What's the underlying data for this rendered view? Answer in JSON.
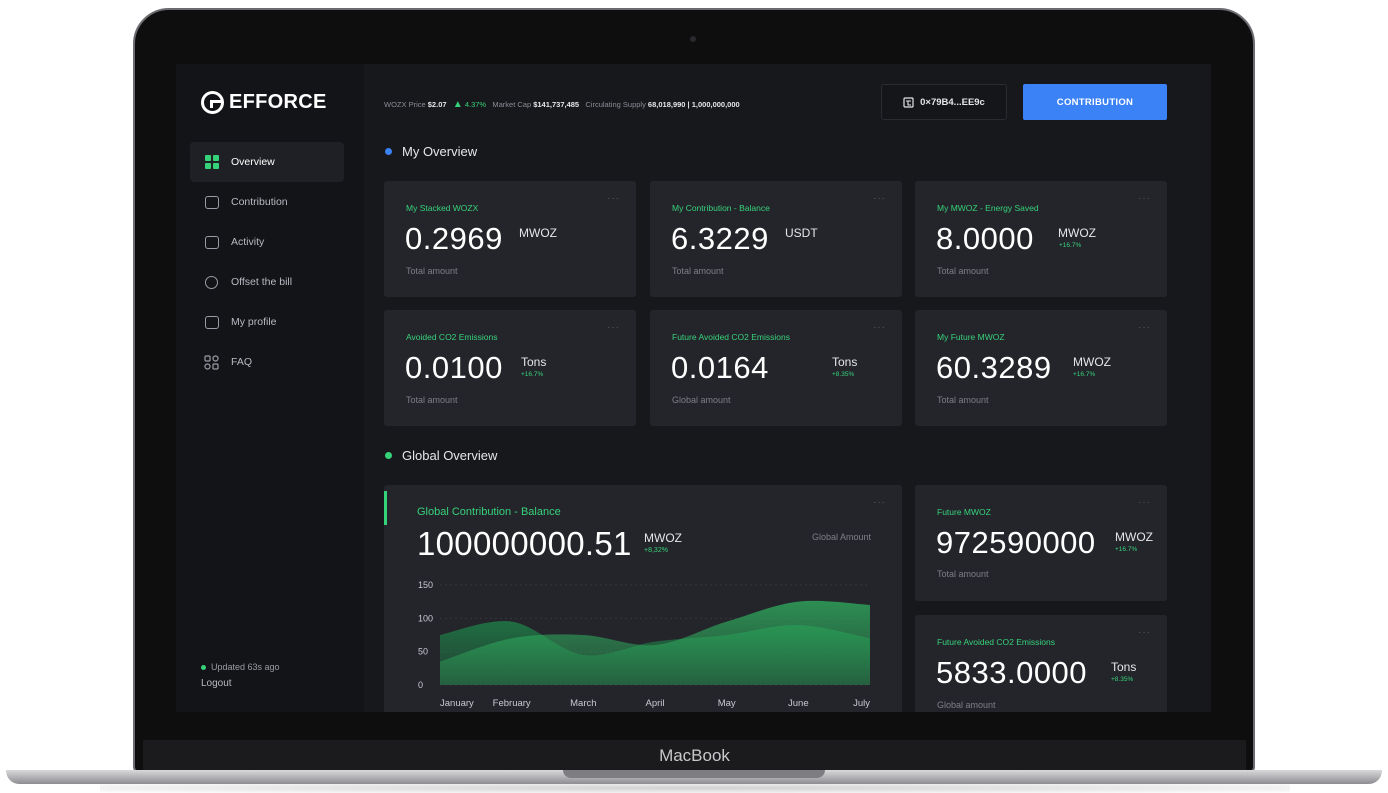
{
  "device": {
    "label": "MacBook"
  },
  "brand": {
    "name": "EFFORCE"
  },
  "sidebar": {
    "items": [
      {
        "label": "Overview",
        "icon": "grid-icon",
        "active": true
      },
      {
        "label": "Contribution",
        "icon": "wallet-icon"
      },
      {
        "label": "Activity",
        "icon": "activity-icon"
      },
      {
        "label": "Offset the bill",
        "icon": "offset-icon"
      },
      {
        "label": "My profile",
        "icon": "profile-icon"
      },
      {
        "label": "FAQ",
        "icon": "faq-icon"
      }
    ],
    "updated": "Updated 63s ago",
    "logout": "Logout"
  },
  "ticker": {
    "price_label": "WOZX Price",
    "price_value": "$2.07",
    "change_value": "4.37%",
    "marketcap_label": "Market Cap",
    "marketcap_value": "$141,737,485",
    "supply_label": "Circulating Supply",
    "supply_value": "68,018,990 | 1,000,000,000"
  },
  "header": {
    "wallet": "0×79B4...EE9c",
    "contribution_button": "CONTRIBUTION"
  },
  "colors": {
    "accent_green": "#36d27a",
    "accent_blue": "#3b82f6"
  },
  "my_overview": {
    "title": "My Overview",
    "cards": [
      {
        "label": "My Stacked WOZX",
        "value": "0.2969",
        "unit": "MWOZ",
        "change": "",
        "sub": "Total amount"
      },
      {
        "label": "My Contribution - Balance",
        "value": "6.3229",
        "unit": "USDT",
        "change": "",
        "sub": "Total amount"
      },
      {
        "label": "My MWOZ - Energy Saved",
        "value": "8.0000",
        "unit": "MWOZ",
        "change": "+16.7%",
        "sub": "Total amount"
      },
      {
        "label": "Avoided CO2 Emissions",
        "value": "0.0100",
        "unit": "Tons",
        "change": "+16.7%",
        "sub": "Total amount"
      },
      {
        "label": "Future Avoided CO2 Emissions",
        "value": "0.0164",
        "unit": "Tons",
        "change": "+8.35%",
        "sub": "Global amount"
      },
      {
        "label": "My Future MWOZ",
        "value": "60.3289",
        "unit": "MWOZ",
        "change": "+16.7%",
        "sub": "Total amount"
      }
    ]
  },
  "global_overview": {
    "title": "Global Overview",
    "main_card": {
      "label": "Global Contribution - Balance",
      "value": "100000000.51",
      "unit": "MWOZ",
      "change": "+8,32%",
      "global": "Global Amount"
    },
    "side_cards": [
      {
        "label": "Future MWOZ",
        "value": "972590000",
        "unit": "MWOZ",
        "change": "+16.7%",
        "sub": "Total amount"
      },
      {
        "label": "Future Avoided CO2 Emissions",
        "value": "5833.0000",
        "unit": "Tons",
        "change": "+8.35%",
        "sub": "Global amount"
      }
    ]
  },
  "chart_data": {
    "type": "area",
    "categories": [
      "January",
      "February",
      "March",
      "April",
      "May",
      "June",
      "July"
    ],
    "ylim": [
      0,
      150
    ],
    "yticks": [
      0,
      50,
      100,
      150
    ],
    "series": [
      {
        "values": [
          75,
          95,
          45,
          65,
          75,
          90,
          70
        ],
        "color": "#1f7a46"
      },
      {
        "values": [
          35,
          70,
          75,
          60,
          95,
          125,
          120
        ],
        "color": "#2ea85c"
      }
    ]
  }
}
